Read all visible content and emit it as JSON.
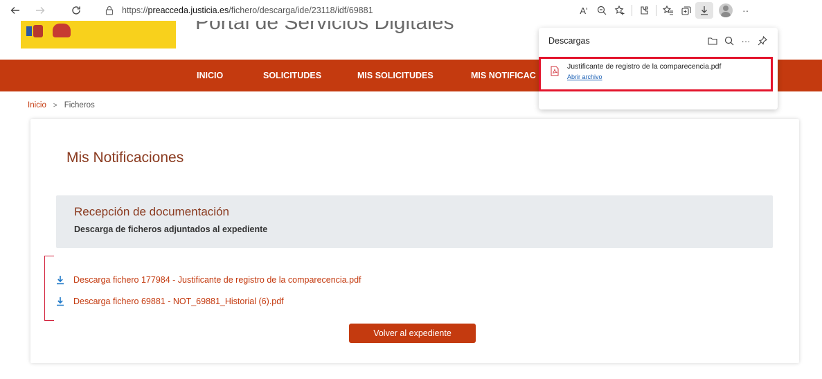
{
  "browser": {
    "url_prefix": "https://",
    "url_host": "preacceda.justicia.es",
    "url_path": "/fichero/descarga/ide/23118/idf/69881",
    "read_aloud": "Aʹ",
    "more": "··"
  },
  "header": {
    "portal_title": "Portal de Servicios Digitales"
  },
  "nav": {
    "items": [
      "INICIO",
      "SOLICITUDES",
      "MIS SOLICITUDES",
      "MIS NOTIFICAC"
    ]
  },
  "breadcrumb": {
    "home": "Inicio",
    "separator": ">",
    "current": "Ficheros"
  },
  "page": {
    "title": "Mis Notificaciones",
    "section_title": "Recepción de documentación",
    "section_subtitle": "Descarga de ficheros adjuntados al expediente",
    "downloads": [
      "Descarga fichero 177984 - Justificante de registro de la comparecencia.pdf",
      "Descarga fichero 69881 - NOT_69881_Historial (6).pdf"
    ],
    "back_button": "Volver al expediente"
  },
  "downloads_panel": {
    "title": "Descargas",
    "more_icon": "···",
    "file_name": "Justificante de registro de la comparecencia.pdf",
    "open_link": "Abrir archivo"
  },
  "colors": {
    "brand": "#c43a0f",
    "title": "#8a3a1f",
    "highlight": "#e3142c",
    "link_blue": "#1a5fb4",
    "download_icon": "#1e78c8"
  }
}
